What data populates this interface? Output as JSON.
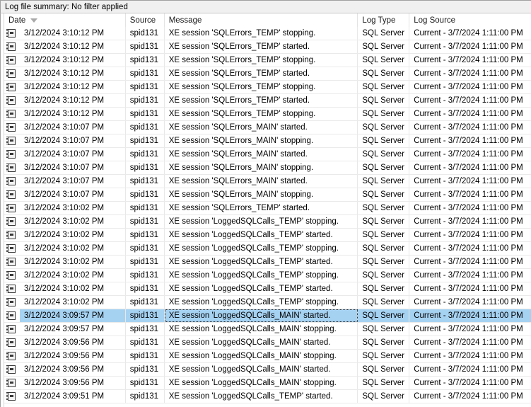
{
  "summary": {
    "text": "Log file summary: No filter applied"
  },
  "columns": [
    {
      "key": "date",
      "label": "Date",
      "sort": "descending"
    },
    {
      "key": "src",
      "label": "Source",
      "sort": ""
    },
    {
      "key": "msg",
      "label": "Message",
      "sort": ""
    },
    {
      "key": "type",
      "label": "Log Type",
      "sort": ""
    },
    {
      "key": "lsrc",
      "label": "Log Source",
      "sort": ""
    }
  ],
  "icon": {
    "name": "log-entry-notepad-icon"
  },
  "colors": {
    "selection": "#a6d2f2",
    "header_text": "#1a1a1a",
    "summary_bg": "#f0f0f0",
    "row_separator": "#eaeaea"
  },
  "rows": [
    {
      "date": "3/12/2024 3:10:12 PM",
      "src": "spid131",
      "msg": "XE session 'SQLErrors_TEMP' stopping.",
      "type": "SQL Server",
      "lsrc": "Current - 3/7/2024 1:11:00 PM",
      "selected": false
    },
    {
      "date": "3/12/2024 3:10:12 PM",
      "src": "spid131",
      "msg": "XE session 'SQLErrors_TEMP' started.",
      "type": "SQL Server",
      "lsrc": "Current - 3/7/2024 1:11:00 PM",
      "selected": false
    },
    {
      "date": "3/12/2024 3:10:12 PM",
      "src": "spid131",
      "msg": "XE session 'SQLErrors_TEMP' stopping.",
      "type": "SQL Server",
      "lsrc": "Current - 3/7/2024 1:11:00 PM",
      "selected": false
    },
    {
      "date": "3/12/2024 3:10:12 PM",
      "src": "spid131",
      "msg": "XE session 'SQLErrors_TEMP' started.",
      "type": "SQL Server",
      "lsrc": "Current - 3/7/2024 1:11:00 PM",
      "selected": false
    },
    {
      "date": "3/12/2024 3:10:12 PM",
      "src": "spid131",
      "msg": "XE session 'SQLErrors_TEMP' stopping.",
      "type": "SQL Server",
      "lsrc": "Current - 3/7/2024 1:11:00 PM",
      "selected": false
    },
    {
      "date": "3/12/2024 3:10:12 PM",
      "src": "spid131",
      "msg": "XE session 'SQLErrors_TEMP' started.",
      "type": "SQL Server",
      "lsrc": "Current - 3/7/2024 1:11:00 PM",
      "selected": false
    },
    {
      "date": "3/12/2024 3:10:12 PM",
      "src": "spid131",
      "msg": "XE session 'SQLErrors_TEMP' stopping.",
      "type": "SQL Server",
      "lsrc": "Current - 3/7/2024 1:11:00 PM",
      "selected": false
    },
    {
      "date": "3/12/2024 3:10:07 PM",
      "src": "spid131",
      "msg": "XE session 'SQLErrors_MAIN' started.",
      "type": "SQL Server",
      "lsrc": "Current - 3/7/2024 1:11:00 PM",
      "selected": false
    },
    {
      "date": "3/12/2024 3:10:07 PM",
      "src": "spid131",
      "msg": "XE session 'SQLErrors_MAIN' stopping.",
      "type": "SQL Server",
      "lsrc": "Current - 3/7/2024 1:11:00 PM",
      "selected": false
    },
    {
      "date": "3/12/2024 3:10:07 PM",
      "src": "spid131",
      "msg": "XE session 'SQLErrors_MAIN' started.",
      "type": "SQL Server",
      "lsrc": "Current - 3/7/2024 1:11:00 PM",
      "selected": false
    },
    {
      "date": "3/12/2024 3:10:07 PM",
      "src": "spid131",
      "msg": "XE session 'SQLErrors_MAIN' stopping.",
      "type": "SQL Server",
      "lsrc": "Current - 3/7/2024 1:11:00 PM",
      "selected": false
    },
    {
      "date": "3/12/2024 3:10:07 PM",
      "src": "spid131",
      "msg": "XE session 'SQLErrors_MAIN' started.",
      "type": "SQL Server",
      "lsrc": "Current - 3/7/2024 1:11:00 PM",
      "selected": false
    },
    {
      "date": "3/12/2024 3:10:07 PM",
      "src": "spid131",
      "msg": "XE session 'SQLErrors_MAIN' stopping.",
      "type": "SQL Server",
      "lsrc": "Current - 3/7/2024 1:11:00 PM",
      "selected": false
    },
    {
      "date": "3/12/2024 3:10:02 PM",
      "src": "spid131",
      "msg": "XE session 'SQLErrors_TEMP' started.",
      "type": "SQL Server",
      "lsrc": "Current - 3/7/2024 1:11:00 PM",
      "selected": false
    },
    {
      "date": "3/12/2024 3:10:02 PM",
      "src": "spid131",
      "msg": "XE session 'LoggedSQLCalls_TEMP' stopping.",
      "type": "SQL Server",
      "lsrc": "Current - 3/7/2024 1:11:00 PM",
      "selected": false
    },
    {
      "date": "3/12/2024 3:10:02 PM",
      "src": "spid131",
      "msg": "XE session 'LoggedSQLCalls_TEMP' started.",
      "type": "SQL Server",
      "lsrc": "Current - 3/7/2024 1:11:00 PM",
      "selected": false
    },
    {
      "date": "3/12/2024 3:10:02 PM",
      "src": "spid131",
      "msg": "XE session 'LoggedSQLCalls_TEMP' stopping.",
      "type": "SQL Server",
      "lsrc": "Current - 3/7/2024 1:11:00 PM",
      "selected": false
    },
    {
      "date": "3/12/2024 3:10:02 PM",
      "src": "spid131",
      "msg": "XE session 'LoggedSQLCalls_TEMP' started.",
      "type": "SQL Server",
      "lsrc": "Current - 3/7/2024 1:11:00 PM",
      "selected": false
    },
    {
      "date": "3/12/2024 3:10:02 PM",
      "src": "spid131",
      "msg": "XE session 'LoggedSQLCalls_TEMP' stopping.",
      "type": "SQL Server",
      "lsrc": "Current - 3/7/2024 1:11:00 PM",
      "selected": false
    },
    {
      "date": "3/12/2024 3:10:02 PM",
      "src": "spid131",
      "msg": "XE session 'LoggedSQLCalls_TEMP' started.",
      "type": "SQL Server",
      "lsrc": "Current - 3/7/2024 1:11:00 PM",
      "selected": false
    },
    {
      "date": "3/12/2024 3:10:02 PM",
      "src": "spid131",
      "msg": "XE session 'LoggedSQLCalls_TEMP' stopping.",
      "type": "SQL Server",
      "lsrc": "Current - 3/7/2024 1:11:00 PM",
      "selected": false
    },
    {
      "date": "3/12/2024 3:09:57 PM",
      "src": "spid131",
      "msg": "XE session 'LoggedSQLCalls_MAIN' started.",
      "type": "SQL Server",
      "lsrc": "Current - 3/7/2024 1:11:00 PM",
      "selected": true
    },
    {
      "date": "3/12/2024 3:09:57 PM",
      "src": "spid131",
      "msg": "XE session 'LoggedSQLCalls_MAIN' stopping.",
      "type": "SQL Server",
      "lsrc": "Current - 3/7/2024 1:11:00 PM",
      "selected": false
    },
    {
      "date": "3/12/2024 3:09:56 PM",
      "src": "spid131",
      "msg": "XE session 'LoggedSQLCalls_MAIN' started.",
      "type": "SQL Server",
      "lsrc": "Current - 3/7/2024 1:11:00 PM",
      "selected": false
    },
    {
      "date": "3/12/2024 3:09:56 PM",
      "src": "spid131",
      "msg": "XE session 'LoggedSQLCalls_MAIN' stopping.",
      "type": "SQL Server",
      "lsrc": "Current - 3/7/2024 1:11:00 PM",
      "selected": false
    },
    {
      "date": "3/12/2024 3:09:56 PM",
      "src": "spid131",
      "msg": "XE session 'LoggedSQLCalls_MAIN' started.",
      "type": "SQL Server",
      "lsrc": "Current - 3/7/2024 1:11:00 PM",
      "selected": false
    },
    {
      "date": "3/12/2024 3:09:56 PM",
      "src": "spid131",
      "msg": "XE session 'LoggedSQLCalls_MAIN' stopping.",
      "type": "SQL Server",
      "lsrc": "Current - 3/7/2024 1:11:00 PM",
      "selected": false
    },
    {
      "date": "3/12/2024 3:09:51 PM",
      "src": "spid131",
      "msg": "XE session 'LoggedSQLCalls_TEMP' started.",
      "type": "SQL Server",
      "lsrc": "Current - 3/7/2024 1:11:00 PM",
      "selected": false
    }
  ]
}
